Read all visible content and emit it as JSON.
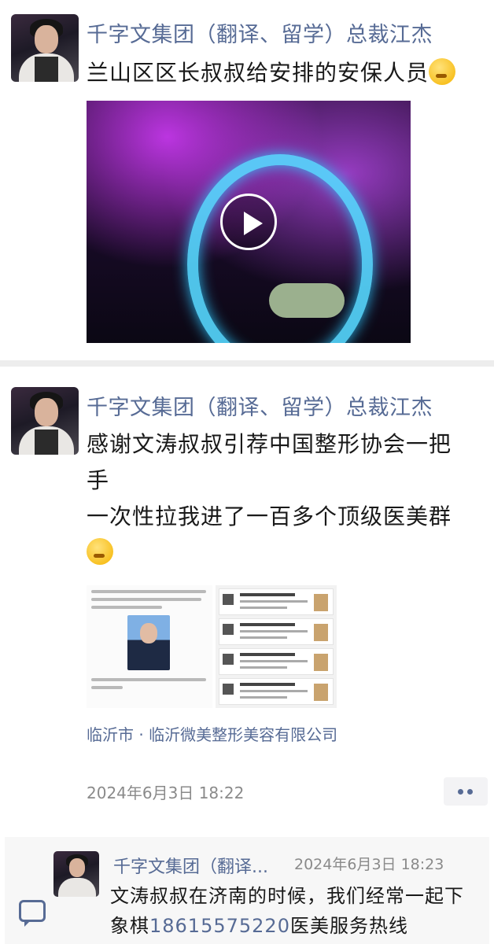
{
  "post1": {
    "nickname": "千字文集团（翻译、留学）总裁江杰",
    "text": "兰山区区长叔叔给安排的安保人员",
    "emoji": "thinking-face-emoji",
    "media_type": "video",
    "play_icon": "play-icon"
  },
  "post2": {
    "nickname": "千字文集团（翻译、留学）总裁江杰",
    "text_line1": "感谢文涛叔叔引荐中国整形协会一把",
    "text_line2": "手",
    "text_line3": "一次性拉我进了一百多个顶级医美群",
    "emoji": "face-with-tears-emoji",
    "location": "临沂市 · 临沂微美整形美容有限公司",
    "time": "2024年6月3日 18:22",
    "more_icon": "more-dots-icon"
  },
  "comment": {
    "nickname": "千字文集团（翻译...",
    "time": "2024年6月3日 18:23",
    "text_part1": "文涛叔叔在济南的时候，我们经常一起下象棋",
    "phone": "18615575220",
    "text_part2": "医美服务热线",
    "icon": "comment-icon"
  },
  "colors": {
    "link": "#576b95",
    "divider": "#ededed",
    "comment_bg": "#f7f7f7"
  }
}
